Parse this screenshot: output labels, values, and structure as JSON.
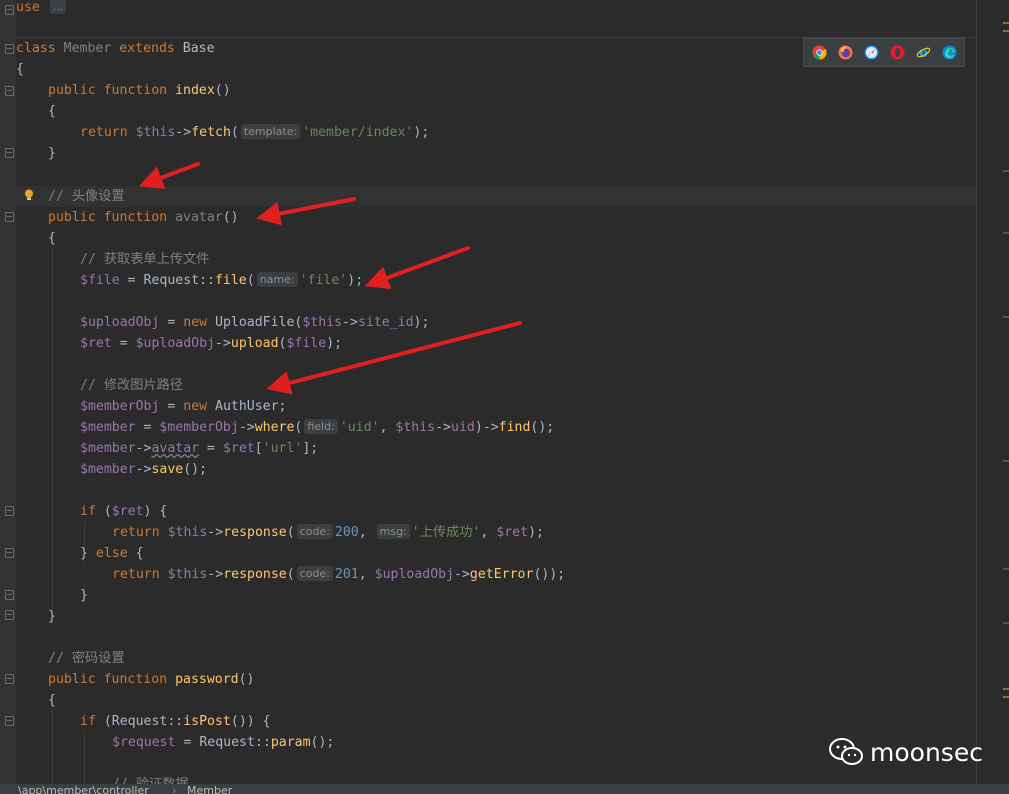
{
  "breadcrumb": {
    "path": "\\app\\member\\controller",
    "separator": "›",
    "class_name": "Member"
  },
  "browser_icons": [
    "chrome-icon",
    "firefox-icon",
    "safari-icon",
    "opera-icon",
    "ie-icon",
    "edge-icon"
  ],
  "watermark": {
    "text": "moonsec",
    "icon": "wechat-icon"
  },
  "colors": {
    "keyword": "#cc7832",
    "function": "#ffc66d",
    "string": "#6a8759",
    "comment": "#808080",
    "variable": "#9876aa",
    "number": "#6897bb",
    "default": "#a9b7c6",
    "background": "#2b2b2b",
    "annotation_arrow": "#e02020"
  },
  "code": {
    "l0_kw": "use",
    "l0_fold": "...",
    "l2_kw_class": "class",
    "l2_name": "Member",
    "l2_kw_extends": "extends",
    "l2_base": "Base",
    "l3": "{",
    "l4_public": "public",
    "l4_function": "function",
    "l4_name": "index",
    "l4_parens": "()",
    "l5": "{",
    "l6_return": "return",
    "l6_this": "$this",
    "l6_arrow": "->",
    "l6_fetch": "fetch",
    "l6_open": "(",
    "l6_hint": "template:",
    "l6_str": "'member/index'",
    "l6_close": ");",
    "l7": "}",
    "l9_comment": "// 头像设置",
    "l10_public": "public",
    "l10_function": "function",
    "l10_name": "avatar",
    "l10_parens": "()",
    "l11": "{",
    "l12_comment": "// 获取表单上传文件",
    "l13_var": "$file",
    "l13_eq": " = Request::",
    "l13_fn": "file",
    "l13_open": "(",
    "l13_hint": "name:",
    "l13_str": "'file'",
    "l13_close": ");",
    "l15_var": "$uploadObj",
    "l15_eq": " = ",
    "l15_new": "new",
    "l15_cls": " UploadFile(",
    "l15_this": "$this",
    "l15_arrow": "->",
    "l15_prop": "site_id",
    "l15_close": ");",
    "l16_var": "$ret",
    "l16_eq": " = ",
    "l16_obj": "$uploadObj",
    "l16_arrow": "->",
    "l16_fn": "upload",
    "l16_open": "(",
    "l16_arg": "$file",
    "l16_close": ");",
    "l18_comment": "// 修改图片路径",
    "l19_var": "$memberObj",
    "l19_eq": " = ",
    "l19_new": "new",
    "l19_cls": " AuthUser;",
    "l20_var": "$member",
    "l20_eq": " = ",
    "l20_obj": "$memberObj",
    "l20_arrow": "->",
    "l20_fn": "where",
    "l20_open": "(",
    "l20_hint": "field:",
    "l20_str": "'uid'",
    "l20_comma": ", ",
    "l20_this": "$this",
    "l20_arrow2": "->",
    "l20_prop": "uid",
    "l20_mid": ")->",
    "l20_find": "find",
    "l20_close": "();",
    "l21_var": "$member",
    "l21_arrow": "->",
    "l21_prop": "avatar",
    "l21_eq": " = ",
    "l21_ret": "$ret",
    "l21_open": "[",
    "l21_str": "'url'",
    "l21_close": "];",
    "l22_var": "$member",
    "l22_arrow": "->",
    "l22_fn": "save",
    "l22_close": "();",
    "l24_if": "if",
    "l24_open": " (",
    "l24_var": "$ret",
    "l24_close": ") {",
    "l25_return": "return",
    "l25_this": "$this",
    "l25_arrow": "->",
    "l25_fn": "response",
    "l25_open": "(",
    "l25_hint1": "code:",
    "l25_num": "200",
    "l25_comma": ", ",
    "l25_hint2": "msg:",
    "l25_str": "'上传成功'",
    "l25_comma2": ", ",
    "l25_var": "$ret",
    "l25_close": ");",
    "l26_brace": "} ",
    "l26_else": "else",
    "l26_open": " {",
    "l27_return": "return",
    "l27_this": "$this",
    "l27_arrow": "->",
    "l27_fn": "response",
    "l27_open": "(",
    "l27_hint": "code:",
    "l27_num": "201",
    "l27_comma": ", ",
    "l27_obj": "$uploadObj",
    "l27_arrow2": "->",
    "l27_fn2": "getError",
    "l27_close": "());",
    "l28": "}",
    "l29": "}",
    "l31_comment": "// 密码设置",
    "l32_public": "public",
    "l32_function": "function",
    "l32_name": "password",
    "l32_parens": "()",
    "l33": "{",
    "l34_if": "if",
    "l34_open": " (Request::",
    "l34_fn": "isPost",
    "l34_close": "()) {",
    "l35_var": "$request",
    "l35_eq": " = Request::",
    "l35_fn": "param",
    "l35_close": "();",
    "l37_comment": "// 验证数据"
  }
}
